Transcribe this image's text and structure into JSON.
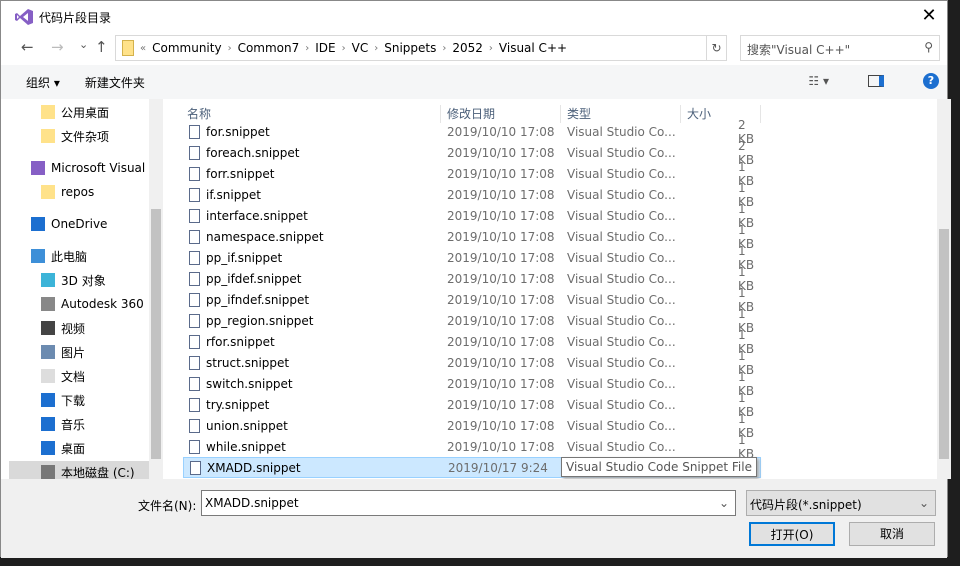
{
  "window": {
    "title": "代码片段目录",
    "close": "✕"
  },
  "nav": {
    "back": "←",
    "forward": "→",
    "recent": "⌄",
    "up": "↑",
    "breadcrumb": [
      "Community",
      "Common7",
      "IDE",
      "VC",
      "Snippets",
      "2052",
      "Visual C++"
    ],
    "overflow": "«",
    "refresh": "↻",
    "search_placeholder": "搜索\"Visual C++\""
  },
  "toolbar": {
    "organize": "组织 ▾",
    "new_folder": "新建文件夹",
    "help": "?"
  },
  "sidebar": {
    "items": [
      {
        "label": "公用桌面",
        "icon": "folder-icon"
      },
      {
        "label": "文件杂项",
        "icon": "folder-icon"
      },
      {
        "label": "Microsoft Visual",
        "icon": "visual-studio-icon"
      },
      {
        "label": "repos",
        "icon": "folder-icon"
      },
      {
        "label": "OneDrive",
        "icon": "cloud-icon"
      },
      {
        "label": "此电脑",
        "icon": "computer-icon"
      },
      {
        "label": "3D 对象",
        "icon": "cube-icon"
      },
      {
        "label": "Autodesk 360",
        "icon": "autodesk-icon"
      },
      {
        "label": "视频",
        "icon": "video-icon"
      },
      {
        "label": "图片",
        "icon": "picture-icon"
      },
      {
        "label": "文档",
        "icon": "document-icon"
      },
      {
        "label": "下载",
        "icon": "download-icon"
      },
      {
        "label": "音乐",
        "icon": "music-icon"
      },
      {
        "label": "桌面",
        "icon": "desktop-icon"
      },
      {
        "label": "本地磁盘 (C:)",
        "icon": "drive-icon"
      }
    ]
  },
  "columns": {
    "name": "名称",
    "date": "修改日期",
    "type": "类型",
    "size": "大小"
  },
  "files": [
    {
      "name": "for.snippet",
      "date": "2019/10/10 17:08",
      "type": "Visual Studio Co...",
      "size": "2 KB"
    },
    {
      "name": "foreach.snippet",
      "date": "2019/10/10 17:08",
      "type": "Visual Studio Co...",
      "size": "2 KB"
    },
    {
      "name": "forr.snippet",
      "date": "2019/10/10 17:08",
      "type": "Visual Studio Co...",
      "size": "1 KB"
    },
    {
      "name": "if.snippet",
      "date": "2019/10/10 17:08",
      "type": "Visual Studio Co...",
      "size": "1 KB"
    },
    {
      "name": "interface.snippet",
      "date": "2019/10/10 17:08",
      "type": "Visual Studio Co...",
      "size": "1 KB"
    },
    {
      "name": "namespace.snippet",
      "date": "2019/10/10 17:08",
      "type": "Visual Studio Co...",
      "size": "1 KB"
    },
    {
      "name": "pp_if.snippet",
      "date": "2019/10/10 17:08",
      "type": "Visual Studio Co...",
      "size": "1 KB"
    },
    {
      "name": "pp_ifdef.snippet",
      "date": "2019/10/10 17:08",
      "type": "Visual Studio Co...",
      "size": "1 KB"
    },
    {
      "name": "pp_ifndef.snippet",
      "date": "2019/10/10 17:08",
      "type": "Visual Studio Co...",
      "size": "1 KB"
    },
    {
      "name": "pp_region.snippet",
      "date": "2019/10/10 17:08",
      "type": "Visual Studio Co...",
      "size": "1 KB"
    },
    {
      "name": "rfor.snippet",
      "date": "2019/10/10 17:08",
      "type": "Visual Studio Co...",
      "size": "1 KB"
    },
    {
      "name": "struct.snippet",
      "date": "2019/10/10 17:08",
      "type": "Visual Studio Co...",
      "size": "1 KB"
    },
    {
      "name": "switch.snippet",
      "date": "2019/10/10 17:08",
      "type": "Visual Studio Co...",
      "size": "1 KB"
    },
    {
      "name": "try.snippet",
      "date": "2019/10/10 17:08",
      "type": "Visual Studio Co...",
      "size": "1 KB"
    },
    {
      "name": "union.snippet",
      "date": "2019/10/10 17:08",
      "type": "Visual Studio Co...",
      "size": "1 KB"
    },
    {
      "name": "while.snippet",
      "date": "2019/10/10 17:08",
      "type": "Visual Studio Co...",
      "size": "1 KB"
    },
    {
      "name": "XMADD.snippet",
      "date": "2019/10/17 9:24",
      "type": "",
      "size": "",
      "selected": true
    }
  ],
  "tooltip": "Visual Studio Code Snippet File",
  "bottom": {
    "filename_label": "文件名(N):",
    "filename_value": "XMADD.snippet",
    "filetype": "代码片段(*.snippet)",
    "open": "打开(O)",
    "cancel": "取消"
  },
  "colors": {
    "accent": "#0078d7",
    "selection": "#cce8ff"
  }
}
